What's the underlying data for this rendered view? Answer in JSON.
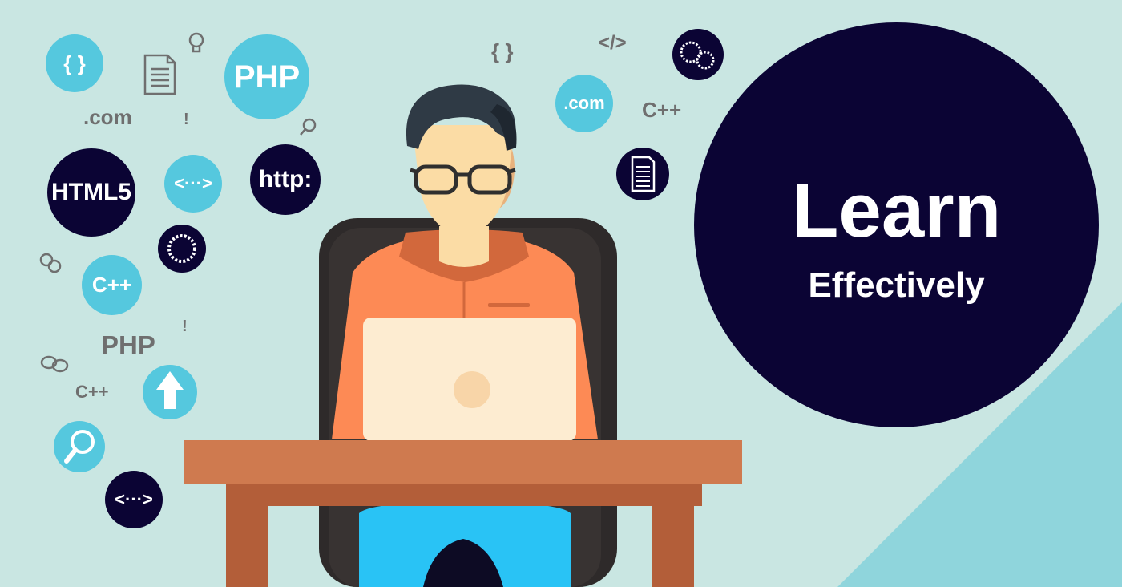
{
  "headline": {
    "title": "Learn",
    "subtitle": "Effectively"
  },
  "tags": {
    "php_large": "PHP",
    "html5": "HTML5",
    "http": "http:",
    "code_tag_1": "<···>",
    "code_tag_2": "<···>",
    "cpp_bubble": "C++",
    "com_bubble": ".com",
    "braces_bubble": "{ }",
    "com_text": ".com",
    "php_text": "PHP",
    "cpp_text_1": "C++",
    "cpp_text_2": "C++",
    "braces_text": "{ }",
    "closing_tag_text": "</>",
    "exclaim_1": "!",
    "exclaim_2": "!"
  },
  "icons": [
    "lightbulb-icon",
    "document-icon",
    "magnifier-icon",
    "gear-icon",
    "gears-icon",
    "chat-bubbles-icon",
    "upload-arrow-icon",
    "search-icon",
    "dual-gears-icon",
    "file-icon"
  ],
  "colors": {
    "background": "#c9e6e2",
    "accent_cyan": "#55c8de",
    "navy": "#0b0434",
    "shirt_orange": "#fd8a55",
    "desk_brown": "#cf7a4f",
    "laptop_cream": "#fdecd1",
    "chair_dark": "#2e2a2a",
    "jeans_blue": "#29c3f5"
  }
}
